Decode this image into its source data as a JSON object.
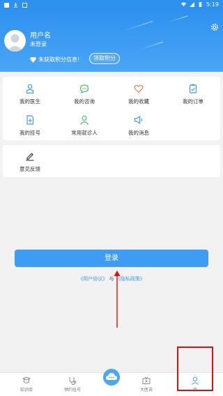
{
  "status": {
    "time": "5:19"
  },
  "profile": {
    "username": "用户名",
    "login_state": "未登录",
    "points_text": "未获取积分信息!",
    "points_button": "领取积分"
  },
  "menu": [
    {
      "label": "我的医生",
      "icon": "doctor-icon",
      "color": "#3d9cf3"
    },
    {
      "label": "我的咨询",
      "icon": "chat-icon",
      "color": "#4cbf6a"
    },
    {
      "label": "我的收藏",
      "icon": "heart-icon",
      "color": "#f0803c"
    },
    {
      "label": "我的订单",
      "icon": "order-icon",
      "color": "#3d9cf3"
    },
    {
      "label": "我的挂号",
      "icon": "register-icon",
      "color": "#3d9cf3"
    },
    {
      "label": "常用就诊人",
      "icon": "patient-icon",
      "color": "#4cbf6a"
    },
    {
      "label": "我的消息",
      "icon": "message-icon",
      "color": "#3d9cf3"
    }
  ],
  "feedback": {
    "label": "意见反馈"
  },
  "login": {
    "button": "登录",
    "agreement_prefix": "《用户协议》",
    "agreement_and": "与",
    "agreement_suffix": "《隐私政策》"
  },
  "tabs": [
    {
      "label": "知识库",
      "icon": "book-icon"
    },
    {
      "label": "预约挂号",
      "icon": "stethoscope-icon"
    },
    {
      "label": "",
      "icon": "center-icon"
    },
    {
      "label": "大医说",
      "icon": "tv-icon"
    },
    {
      "label": "我",
      "icon": "person-icon"
    }
  ]
}
